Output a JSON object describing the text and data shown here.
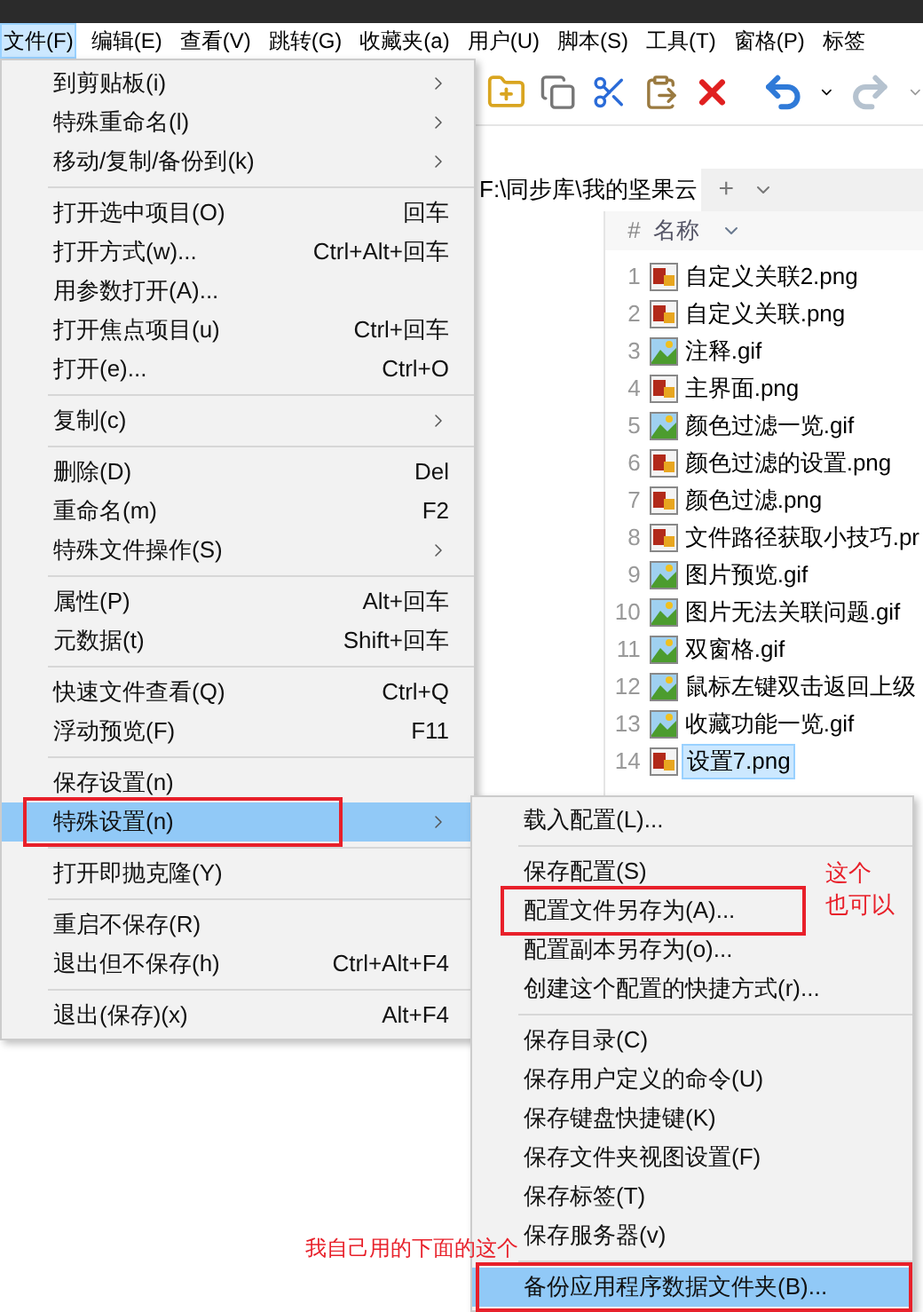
{
  "menubar": [
    {
      "label": "文件(F)",
      "selected": true
    },
    {
      "label": "编辑(E)",
      "selected": false
    },
    {
      "label": "查看(V)",
      "selected": false
    },
    {
      "label": "跳转(G)",
      "selected": false
    },
    {
      "label": "收藏夹(a)",
      "selected": false
    },
    {
      "label": "用户(U)",
      "selected": false
    },
    {
      "label": "脚本(S)",
      "selected": false
    },
    {
      "label": "工具(T)",
      "selected": false
    },
    {
      "label": "窗格(P)",
      "selected": false
    },
    {
      "label": "标签",
      "selected": false
    }
  ],
  "tab": {
    "label": "F:\\同步库\\我的坚果云",
    "add": "+"
  },
  "file_list": {
    "columns": [
      "#",
      "名称"
    ],
    "rows": [
      {
        "num": "1",
        "name": "自定义关联2.png",
        "kind": "png",
        "selected": false
      },
      {
        "num": "2",
        "name": "自定义关联.png",
        "kind": "png",
        "selected": false
      },
      {
        "num": "3",
        "name": "注释.gif",
        "kind": "gif",
        "selected": false
      },
      {
        "num": "4",
        "name": "主界面.png",
        "kind": "png",
        "selected": false
      },
      {
        "num": "5",
        "name": "颜色过滤一览.gif",
        "kind": "gif",
        "selected": false
      },
      {
        "num": "6",
        "name": "颜色过滤的设置.png",
        "kind": "png",
        "selected": false
      },
      {
        "num": "7",
        "name": "颜色过滤.png",
        "kind": "png",
        "selected": false
      },
      {
        "num": "8",
        "name": "文件路径获取小技巧.pr",
        "kind": "png",
        "selected": false
      },
      {
        "num": "9",
        "name": "图片预览.gif",
        "kind": "gif",
        "selected": false
      },
      {
        "num": "10",
        "name": "图片无法关联问题.gif",
        "kind": "gif",
        "selected": false
      },
      {
        "num": "11",
        "name": "双窗格.gif",
        "kind": "gif",
        "selected": false
      },
      {
        "num": "12",
        "name": "鼠标左键双击返回上级",
        "kind": "gif",
        "selected": false
      },
      {
        "num": "13",
        "name": "收藏功能一览.gif",
        "kind": "gif",
        "selected": false
      },
      {
        "num": "14",
        "name": "设置7.png",
        "kind": "png",
        "selected": true
      }
    ]
  },
  "file_menu": [
    {
      "kind": "item",
      "label": "到剪贴板(i)",
      "submenu": true,
      "selected": false
    },
    {
      "kind": "item",
      "label": "特殊重命名(l)",
      "submenu": true,
      "selected": false
    },
    {
      "kind": "item",
      "label": "移动/复制/备份到(k)",
      "submenu": true,
      "selected": false
    },
    {
      "kind": "separator"
    },
    {
      "kind": "item",
      "label": "打开选中项目(O)",
      "shortcut": "回车",
      "selected": false
    },
    {
      "kind": "item",
      "label": "打开方式(w)...",
      "shortcut": "Ctrl+Alt+回车",
      "selected": false
    },
    {
      "kind": "item",
      "label": "用参数打开(A)...",
      "selected": false
    },
    {
      "kind": "item",
      "label": "打开焦点项目(u)",
      "shortcut": "Ctrl+回车",
      "selected": false
    },
    {
      "kind": "item",
      "label": "打开(e)...",
      "shortcut": "Ctrl+O",
      "selected": false
    },
    {
      "kind": "separator"
    },
    {
      "kind": "item",
      "label": "复制(c)",
      "submenu": true,
      "selected": false
    },
    {
      "kind": "separator"
    },
    {
      "kind": "item",
      "label": "删除(D)",
      "shortcut": "Del",
      "selected": false
    },
    {
      "kind": "item",
      "label": "重命名(m)",
      "shortcut": "F2",
      "selected": false
    },
    {
      "kind": "item",
      "label": "特殊文件操作(S)",
      "submenu": true,
      "selected": false
    },
    {
      "kind": "separator"
    },
    {
      "kind": "item",
      "label": "属性(P)",
      "shortcut": "Alt+回车",
      "selected": false
    },
    {
      "kind": "item",
      "label": "元数据(t)",
      "shortcut": "Shift+回车",
      "selected": false
    },
    {
      "kind": "separator"
    },
    {
      "kind": "item",
      "label": "快速文件查看(Q)",
      "shortcut": "Ctrl+Q",
      "selected": false
    },
    {
      "kind": "item",
      "label": "浮动预览(F)",
      "shortcut": "F11",
      "selected": false
    },
    {
      "kind": "separator"
    },
    {
      "kind": "item",
      "label": "保存设置(n)",
      "selected": false
    },
    {
      "kind": "item",
      "label": "特殊设置(n)",
      "submenu": true,
      "selected": true,
      "marked": true
    },
    {
      "kind": "separator"
    },
    {
      "kind": "item",
      "label": "打开即抛克隆(Y)",
      "selected": false
    },
    {
      "kind": "separator"
    },
    {
      "kind": "item",
      "label": "重启不保存(R)",
      "selected": false
    },
    {
      "kind": "item",
      "label": "退出但不保存(h)",
      "shortcut": "Ctrl+Alt+F4",
      "selected": false
    },
    {
      "kind": "separator"
    },
    {
      "kind": "item",
      "label": "退出(保存)(x)",
      "shortcut": "Alt+F4",
      "selected": false
    }
  ],
  "settings_submenu": [
    {
      "kind": "item",
      "label": "载入配置(L)...",
      "selected": false
    },
    {
      "kind": "separator"
    },
    {
      "kind": "item",
      "label": "保存配置(S)",
      "selected": false
    },
    {
      "kind": "item",
      "label": "配置文件另存为(A)...",
      "selected": false,
      "marked": true
    },
    {
      "kind": "item",
      "label": "配置副本另存为(o)...",
      "selected": false
    },
    {
      "kind": "item",
      "label": "创建这个配置的快捷方式(r)...",
      "selected": false
    },
    {
      "kind": "separator"
    },
    {
      "kind": "item",
      "label": "保存目录(C)",
      "selected": false
    },
    {
      "kind": "item",
      "label": "保存用户定义的命令(U)",
      "selected": false
    },
    {
      "kind": "item",
      "label": "保存键盘快捷键(K)",
      "selected": false
    },
    {
      "kind": "item",
      "label": "保存文件夹视图设置(F)",
      "selected": false
    },
    {
      "kind": "item",
      "label": "保存标签(T)",
      "selected": false
    },
    {
      "kind": "item",
      "label": "保存服务器(v)",
      "selected": false
    },
    {
      "kind": "separator"
    },
    {
      "kind": "item",
      "label": "备份应用程序数据文件夹(B)...",
      "selected": true,
      "marked": true
    }
  ],
  "annotations": [
    {
      "lines": [
        "这个",
        "也可以"
      ]
    },
    {
      "lines": [
        "我自己用的下面的这个"
      ]
    }
  ]
}
